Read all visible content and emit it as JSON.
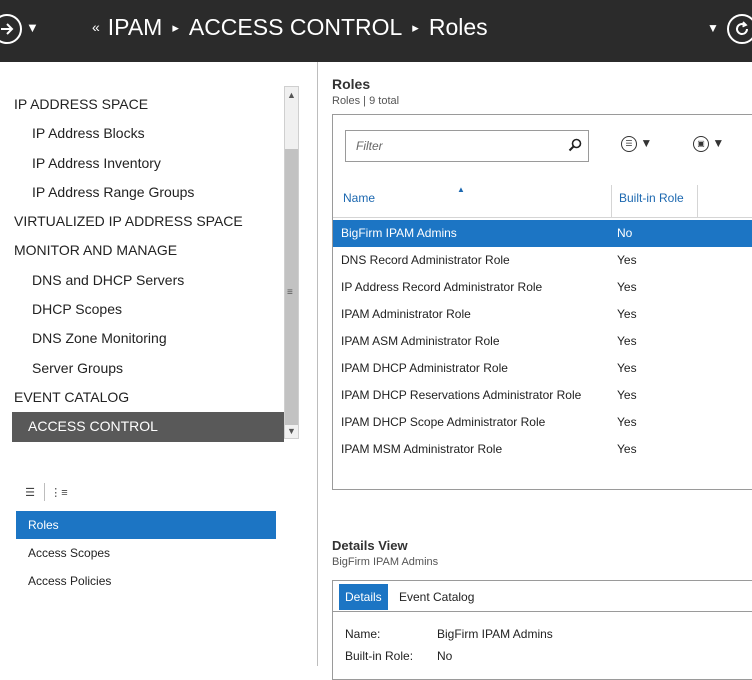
{
  "breadcrumb": {
    "first": "IPAM",
    "second": "ACCESS CONTROL",
    "third": "Roles"
  },
  "nav": {
    "items": [
      {
        "label": "IP ADDRESS SPACE",
        "level": 1
      },
      {
        "label": "IP Address Blocks",
        "level": 2
      },
      {
        "label": "IP Address Inventory",
        "level": 2
      },
      {
        "label": "IP Address Range Groups",
        "level": 2
      },
      {
        "label": "VIRTUALIZED IP ADDRESS SPACE",
        "level": 1
      },
      {
        "label": "MONITOR AND MANAGE",
        "level": 1
      },
      {
        "label": "DNS and DHCP Servers",
        "level": 2
      },
      {
        "label": "DHCP Scopes",
        "level": 2
      },
      {
        "label": "DNS Zone Monitoring",
        "level": 2
      },
      {
        "label": "Server Groups",
        "level": 2
      },
      {
        "label": "EVENT CATALOG",
        "level": 1
      },
      {
        "label": "ACCESS CONTROL",
        "level": 1,
        "selected": true
      }
    ]
  },
  "subnav": {
    "items": [
      {
        "label": "Roles",
        "selected": true
      },
      {
        "label": "Access Scopes"
      },
      {
        "label": "Access Policies"
      }
    ]
  },
  "roles": {
    "title": "Roles",
    "subtitle": "Roles | 9 total",
    "filter_placeholder": "Filter",
    "columns": {
      "name": "Name",
      "builtin": "Built-in Role"
    },
    "rows": [
      {
        "name": "BigFirm IPAM Admins",
        "builtin": "No",
        "selected": true
      },
      {
        "name": "DNS Record Administrator Role",
        "builtin": "Yes"
      },
      {
        "name": "IP Address Record Administrator Role",
        "builtin": "Yes"
      },
      {
        "name": "IPAM Administrator Role",
        "builtin": "Yes"
      },
      {
        "name": "IPAM ASM Administrator Role",
        "builtin": "Yes"
      },
      {
        "name": "IPAM DHCP Administrator Role",
        "builtin": "Yes"
      },
      {
        "name": "IPAM DHCP Reservations Administrator Role",
        "builtin": "Yes"
      },
      {
        "name": "IPAM DHCP Scope Administrator Role",
        "builtin": "Yes"
      },
      {
        "name": "IPAM MSM Administrator Role",
        "builtin": "Yes"
      }
    ]
  },
  "details": {
    "title": "Details View",
    "subtitle": "BigFirm IPAM Admins",
    "tabs": {
      "details": "Details",
      "event_catalog": "Event Catalog"
    },
    "name_label": "Name:",
    "name_value": "BigFirm IPAM Admins",
    "builtin_label": "Built-in Role:",
    "builtin_value": "No"
  },
  "colors": {
    "titlebar": "#2b2b2b",
    "selection": "#1c75c4",
    "nav_selected": "#595959",
    "header_text": "#1c68b0"
  }
}
